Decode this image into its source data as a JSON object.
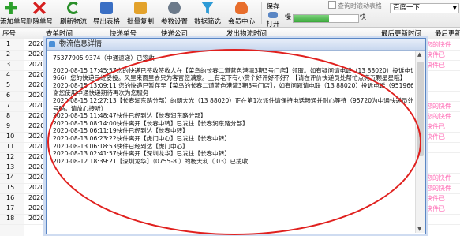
{
  "toolbar": {
    "buttons": [
      {
        "id": "add",
        "label": "添加单号",
        "icon": "plus-icon"
      },
      {
        "id": "delete",
        "label": "删除单号",
        "icon": "delete-x-icon"
      },
      {
        "id": "refresh",
        "label": "刷新物流",
        "icon": "refresh-icon"
      },
      {
        "id": "export",
        "label": "导出表格",
        "icon": "export-table-icon"
      },
      {
        "id": "copy",
        "label": "批量复制",
        "icon": "copy-icon"
      },
      {
        "id": "settings",
        "label": "参数设置",
        "icon": "gear-icon"
      },
      {
        "id": "filter",
        "label": "数据筛选",
        "icon": "filter-icon"
      },
      {
        "id": "member",
        "label": "会员中心",
        "icon": "user-icon"
      }
    ],
    "save": {
      "top": "保存",
      "bottom": "打开"
    },
    "auto_query_label": "查询时滚动表格",
    "speed_slow": "慢",
    "speed_fast": "快",
    "speed_level": 0.55,
    "search_dropdown": "百度一下"
  },
  "grid": {
    "headers": [
      "序号",
      "查单时间",
      "快递单号",
      "快递公司",
      "发出物流时间",
      "",
      "最后更新时间",
      "最后更新"
    ],
    "rows": [
      {
        "no": "1",
        "date": "2020-0",
        "last": "您的快件"
      },
      {
        "no": "2",
        "date": "2020-0",
        "last": "快件已"
      },
      {
        "no": "3",
        "date": "2020-0",
        "last": "快件已"
      },
      {
        "no": "4",
        "date": "2020-0",
        "last": ""
      },
      {
        "no": "5",
        "date": "2020-0",
        "last": ""
      },
      {
        "no": "6",
        "date": "2020-0",
        "last": ""
      },
      {
        "no": "7",
        "date": "2020-0",
        "last": "您的快件"
      },
      {
        "no": "8",
        "date": "2020-0",
        "last": "您的快件"
      },
      {
        "no": "9",
        "date": "2020-0",
        "last": "快件已"
      },
      {
        "no": "10",
        "date": "2020-0",
        "last": "快件已"
      },
      {
        "no": "11",
        "date": "2020-0",
        "last": ""
      },
      {
        "no": "12",
        "date": "2020-0",
        "last": ""
      },
      {
        "no": "13",
        "date": "2020-0",
        "last": ""
      },
      {
        "no": "14",
        "date": "2020-0",
        "last": "您的快件"
      },
      {
        "no": "15",
        "date": "2020-0",
        "last": "您的快件"
      },
      {
        "no": "16",
        "date": "2020-0",
        "last": "快件已"
      },
      {
        "no": "17",
        "date": "2020-0",
        "last": "快件已"
      },
      {
        "no": "18",
        "date": "2020-0",
        "last": ""
      }
    ]
  },
  "dialog": {
    "title": "物流信息详情",
    "lines": [
      "75377905 9374（中通速递）已签收",
      "",
      "2020-08-15 17:45:57您的快递已签收签收人在【菜鸟的长春二道蓝色港湾3期3号门店】领取。如有疑问请电联（13       88020）投诉电话（951",
      "966）您的快递已经妥投。风里来雨里去只为客官您满意。上有老下有小赏个好评好不好？【请在评价快递员处帮忙点亮五颗星星哦】",
      "2020-08-15 13:09:11 您的快递已暂存至【菜鸟的长春二道蓝色港湾3期3号门店】，如有问题请电联（13       88020）投诉电话（951966）感",
      "谢您使用中通快递期待再次为您服务",
      "2020-08-15 12:27:13【长春润东路分部】的朝大光（13       88020）正在第1次派件请保持电话畅通并耐心等待（95720为中通快递员外呼专属",
      "号码，请放心接听）",
      "2020-08-15 11:48:47快件已经到达【长春润东路分部】",
      "2020-08-15 08:14:00快件离开【长春中转】已发往【长春润东路分部】",
      "2020-08-15 06:11:19快件已经到达【长春中转】",
      "2020-08-13 06:23:22快件离开【虎门中心】已发往【长春中转】",
      "2020-08-13 06:18:53快件已经到达【虎门中心】",
      "2020-08-13 02:41:57快件离开【深圳龙华】已发往【长春中转】",
      "2020-08-12 18:39:21【深圳龙华】（0755-8       ）的杨大利（       03）已揽收"
    ]
  }
}
